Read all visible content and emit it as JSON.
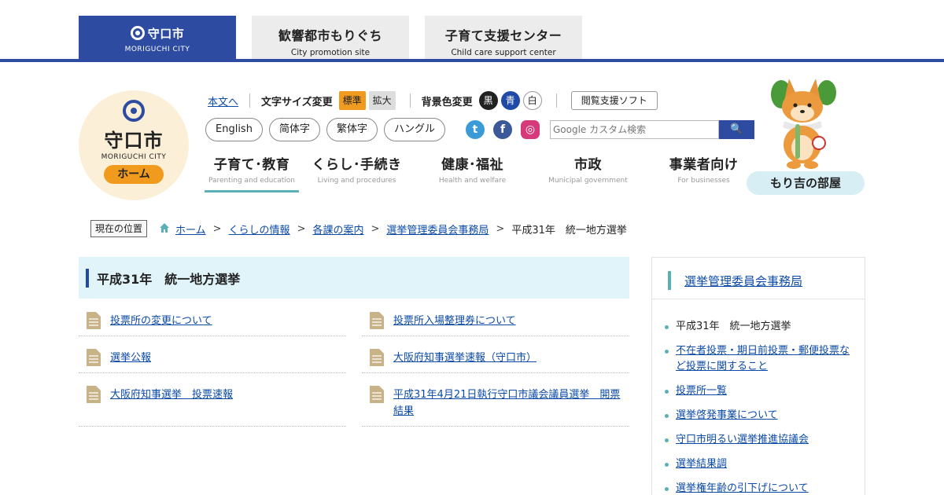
{
  "top_tabs": [
    {
      "main": "守口市",
      "sub": "MORIGUCHI CITY"
    },
    {
      "main": "歓響都市もりぐち",
      "sub": "City promotion site"
    },
    {
      "main": "子育て支援センター",
      "sub": "Child care support center"
    }
  ],
  "logo": {
    "name": "守口市",
    "en": "MORIGUCHI CITY",
    "home": "ホーム"
  },
  "util": {
    "skip": "本文へ",
    "font_size_label": "文字サイズ変更",
    "font_standard": "標準",
    "font_large": "拡大",
    "bg_label": "背景色変更",
    "bg_black": "黒",
    "bg_blue": "青",
    "bg_white": "白",
    "support": "閲覧支援ソフト"
  },
  "languages": [
    "English",
    "简体字",
    "繁体字",
    "ハングル"
  ],
  "social": {
    "twitter": "t",
    "facebook": "f",
    "instagram": "◎"
  },
  "search": {
    "placeholder": "Google カスタム検索",
    "button": "🔍"
  },
  "nav": [
    {
      "jp": "子育て･教育",
      "en": "Parenting and education"
    },
    {
      "jp": "くらし･手続き",
      "en": "Living and procedures"
    },
    {
      "jp": "健康･福祉",
      "en": "Health and welfare"
    },
    {
      "jp": "市政",
      "en": "Municipal government"
    },
    {
      "jp": "事業者向け",
      "en": "For businesses"
    }
  ],
  "mascot_label": "もり吉の部屋",
  "breadcrumb": {
    "label": "現在の位置",
    "items": [
      "ホーム",
      "くらしの情報",
      "各課の案内",
      "選挙管理委員会事務局"
    ],
    "current": "平成31年　統一地方選挙"
  },
  "page_title": "平成31年　統一地方選挙",
  "links": [
    "投票所の変更について",
    "投票所入場整理券について",
    "選挙公報",
    "大阪府知事選挙速報（守口市）",
    "大阪府知事選挙　投票速報",
    "平成31年4月21日執行守口市議会議員選挙　開票結果"
  ],
  "sidebar": {
    "title": "選挙管理委員会事務局",
    "items": [
      "平成31年　統一地方選挙",
      "不在者投票・期日前投票・郵便投票など投票に関すること",
      "投票所一覧",
      "選挙啓発事業について",
      "守口市明るい選挙推進協議会",
      "選挙結果調",
      "選挙権年齢の引下げについて"
    ]
  },
  "colors": {
    "brand": "#2d4ba0",
    "accent": "#f09a1e",
    "teal": "#5bb0b8",
    "heading_bg": "#e0f4fa"
  }
}
